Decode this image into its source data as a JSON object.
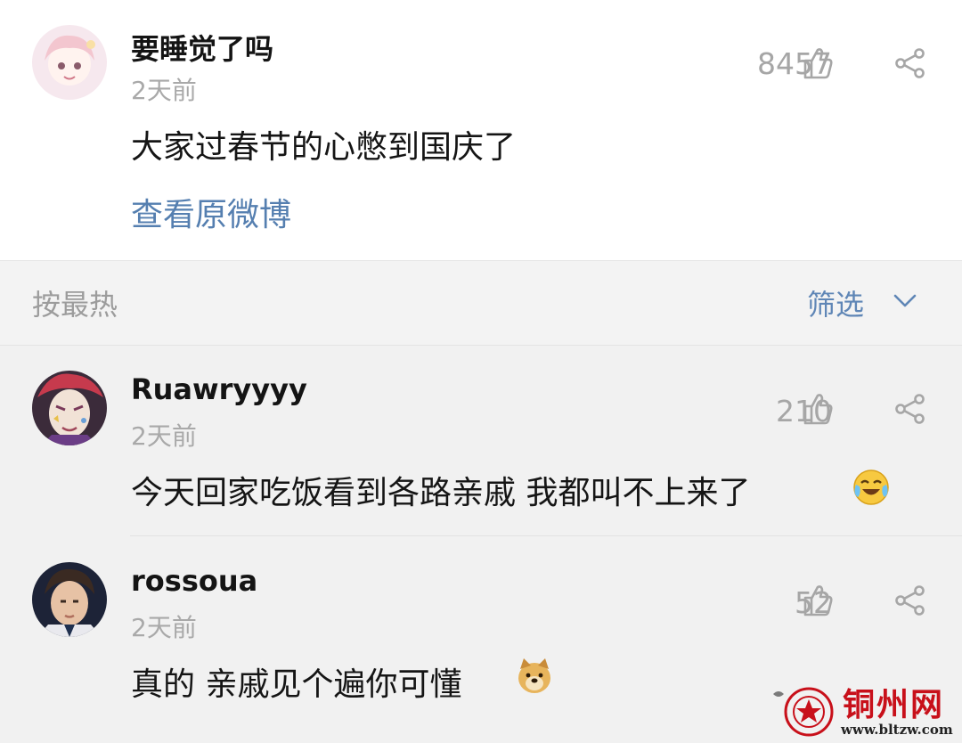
{
  "post": {
    "username": "要睡觉了吗",
    "time": "2天前",
    "likes": "8457",
    "text": "大家过春节的心憋到国庆了",
    "view_original": "查看原微博"
  },
  "sort_bar": {
    "sort_label": "按最热",
    "filter_label": "筛选"
  },
  "comments": [
    {
      "username": "Ruawryyyy",
      "time": "2天前",
      "likes": "210",
      "text": "今天回家吃饭看到各路亲戚 我都叫不上来了",
      "emoji": "laughing-crying-emoji"
    },
    {
      "username": "rossoua",
      "time": "2天前",
      "likes": "52",
      "text": "真的 亲戚见个遍你可懂",
      "emoji": "doge-emoji"
    }
  ],
  "watermark": {
    "title": "铜州网",
    "url": "www.bltzw.com"
  },
  "colors": {
    "link": "#557fb0",
    "meta": "#a9a9a9",
    "background": "#f1f1f1",
    "watermark": "#c8101a"
  }
}
